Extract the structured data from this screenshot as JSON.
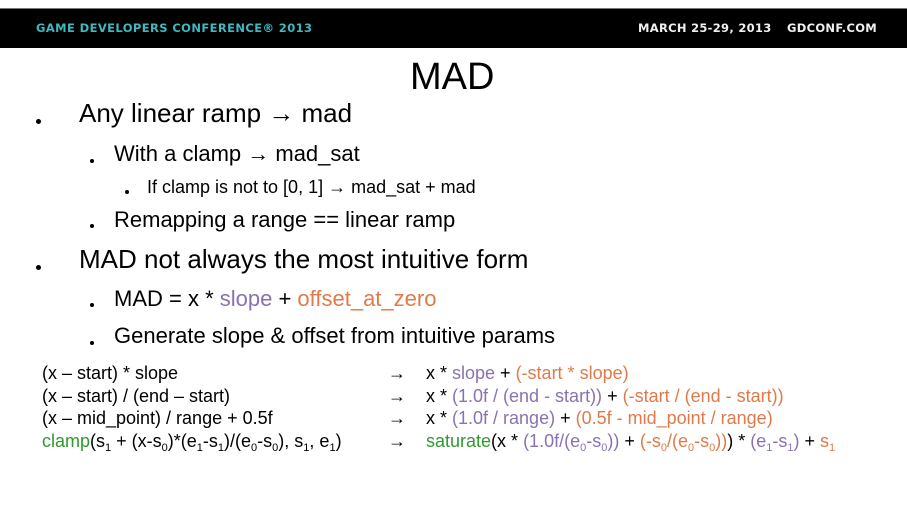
{
  "header": {
    "conference": "GAME DEVELOPERS CONFERENCE® 2013",
    "dates": "MARCH 25-29, 2013",
    "website": "GDCONF.COM",
    "accent_color": "#3fb8c0"
  },
  "slide": {
    "title": "MAD",
    "bullets": [
      {
        "level": 1,
        "text": "Any linear ramp → mad"
      },
      {
        "level": 2,
        "text": "With a clamp → mad_sat"
      },
      {
        "level": 3,
        "text": "If clamp is not to [0, 1] → mad_sat + mad"
      },
      {
        "level": 2,
        "text": "Remapping a range == linear ramp"
      },
      {
        "level": 1,
        "text": "MAD not always the most intuitive form"
      },
      {
        "level": 2,
        "parts": {
          "a": "MAD = x * ",
          "slope": "slope",
          "plus": " + ",
          "offset": "offset_at_zero"
        }
      },
      {
        "level": 2,
        "text": "Generate slope & offset from intuitive params"
      }
    ]
  },
  "colors": {
    "slope": "#8a72b0",
    "offset": "#e07a4a",
    "function": "#2e9a2e"
  },
  "code": {
    "arrow": "→",
    "rows": [
      {
        "left": "(x – start) * slope",
        "r": {
          "x": "x * ",
          "slope": "slope",
          "plus": " + ",
          "offset": "(-start * slope)"
        }
      },
      {
        "left": "(x – start) / (end – start)",
        "r": {
          "x": "x * ",
          "slope": "(1.0f / (end - start))",
          "plus": " + ",
          "offset": "(-start / (end - start))"
        }
      },
      {
        "left": "(x – mid_point) / range + 0.5f",
        "r": {
          "x": "x * ",
          "slope": "(1.0f / range)",
          "plus": " + ",
          "offset": "(0.5f - mid_point / range)"
        }
      },
      {
        "left_fn": "clamp",
        "left_rest": "(s₁ + (x-s₀)*(e₁-s₁)/(e₀-s₀), s₁, e₁)",
        "r": {
          "fn": "saturate",
          "expr": "(x * (1.0f/(e₀-s₀)) + (-s₀/(e₀-s₀))) * (e₁-s₁) + s₁"
        }
      }
    ]
  }
}
